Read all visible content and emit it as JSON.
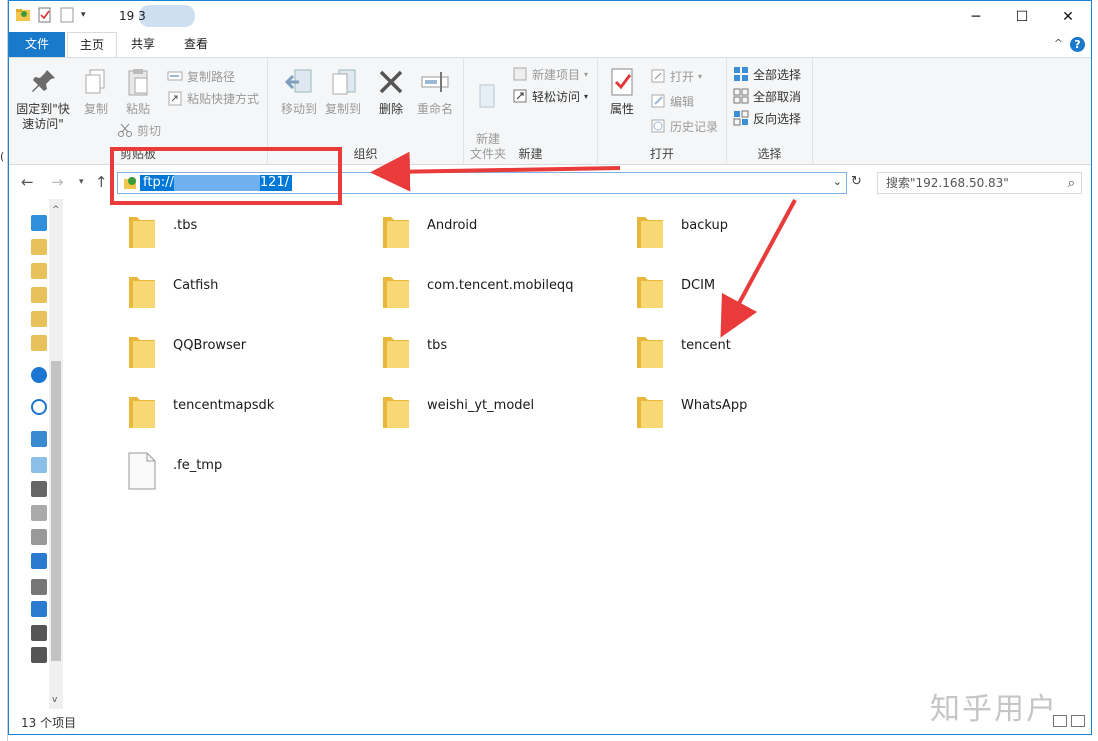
{
  "window": {
    "title": "19 3"
  },
  "ribbon_tabs": [
    "文件",
    "主页",
    "共享",
    "查看"
  ],
  "ribbon": {
    "clipboard": {
      "label": "剪贴板",
      "pin_label": "固定到\"快速访问\"",
      "copy_label": "复制",
      "paste_label": "粘贴",
      "copy_path": "复制路径",
      "paste_shortcut": "粘贴快捷方式",
      "cut": "剪切"
    },
    "organize": {
      "label": "组织",
      "move_to": "移动到",
      "copy_to": "复制到",
      "delete": "删除",
      "rename": "重命名"
    },
    "new": {
      "label": "新建",
      "new_folder": "新建\n文件夹",
      "new_item": "新建项目",
      "easy_access": "轻松访问"
    },
    "open": {
      "label": "打开",
      "properties": "属性",
      "open": "打开",
      "edit": "编辑",
      "history": "历史记录"
    },
    "select": {
      "label": "选择",
      "select_all": "全部选择",
      "select_none": "全部取消",
      "invert": "反向选择"
    }
  },
  "address": {
    "prefix": "ftp://",
    "suffix": "121/"
  },
  "search": {
    "placeholder": "搜索\"192.168.50.83\""
  },
  "items": [
    {
      "name": ".tbs",
      "type": "folder"
    },
    {
      "name": "Android",
      "type": "folder"
    },
    {
      "name": "backup",
      "type": "folder"
    },
    {
      "name": "Catfish",
      "type": "folder"
    },
    {
      "name": "com.tencent.mobileqq",
      "type": "folder"
    },
    {
      "name": "DCIM",
      "type": "folder"
    },
    {
      "name": "QQBrowser",
      "type": "folder"
    },
    {
      "name": "tbs",
      "type": "folder"
    },
    {
      "name": "tencent",
      "type": "folder"
    },
    {
      "name": "tencentmapsdk",
      "type": "folder"
    },
    {
      "name": "weishi_yt_model",
      "type": "folder"
    },
    {
      "name": "WhatsApp",
      "type": "folder"
    },
    {
      "name": ".fe_tmp",
      "type": "file"
    }
  ],
  "status": {
    "count": "13 个项目"
  },
  "watermark": "知乎用户",
  "colors": {
    "accent": "#1979ca",
    "annotation": "#ea3b3b",
    "folder": "#f4c54e"
  }
}
